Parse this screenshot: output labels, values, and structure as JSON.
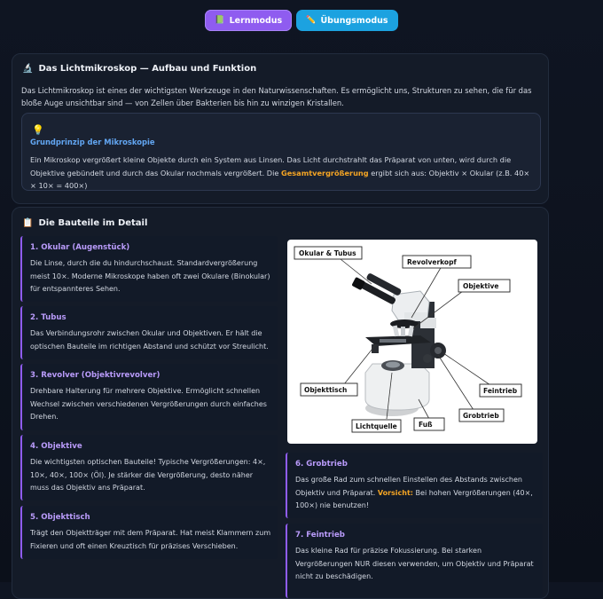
{
  "modes": {
    "learn": {
      "label": "Lernmodus",
      "icon": "book-icon"
    },
    "practice": {
      "label": "Übungsmodus",
      "icon": "pencil-icon"
    }
  },
  "intro_card": {
    "icon": "microscope-icon",
    "title": "Das Lichtmikroskop — Aufbau und Funktion",
    "text": "Das Lichtmikroskop ist eines der wichtigsten Werkzeuge in den Naturwissenschaften. Es ermöglicht uns, Strukturen zu sehen, die für das bloße Auge unsichtbar sind — von Zellen über Bakterien bis hin zu winzigen Kristallen.",
    "principle": {
      "icon": "lightbulb-icon",
      "title": "Grundprinzip der Mikroskopie",
      "text_before": "Ein Mikroskop vergrößert kleine Objekte durch ein System aus Linsen. Das Licht durchstrahlt das Präparat von unten, wird durch die Objektive gebündelt und durch das Okular nochmals vergrößert. Die ",
      "highlight": "Gesamtvergrößerung",
      "text_after": " ergibt sich aus: Objektiv × Okular (z.B. 40× × 10× = 400×)"
    }
  },
  "parts_card": {
    "icon": "clipboard-icon",
    "title": "Die Bauteile im Detail",
    "parts": [
      {
        "title": "1. Okular (Augenstück)",
        "text": "Die Linse, durch die du hindurchschaust. Standardvergrößerung meist 10×. Moderne Mikroskope haben oft zwei Okulare (Binokular) für entspannteres Sehen."
      },
      {
        "title": "2. Tubus",
        "text": "Das Verbindungsrohr zwischen Okular und Objektiven. Er hält die optischen Bauteile im richtigen Abstand und schützt vor Streulicht."
      },
      {
        "title": "3. Revolver (Objektivrevolver)",
        "text": "Drehbare Halterung für mehrere Objektive. Ermöglicht schnellen Wechsel zwischen verschiedenen Vergrößerungen durch einfaches Drehen."
      },
      {
        "title": "4. Objektive",
        "text": "Die wichtigsten optischen Bauteile! Typische Vergrößerungen: 4×, 10×, 40×, 100× (Öl). Je stärker die Vergrößerung, desto näher muss das Objektiv ans Präparat."
      },
      {
        "title": "5. Objekttisch",
        "text": "Trägt den Objektträger mit dem Präparat. Hat meist Klammern zum Fixieren und oft einen Kreuztisch für präzises Verschieben."
      },
      {
        "title": "6. Grobtrieb",
        "text_before": "Das große Rad zum schnellen Einstellen des Abstands zwischen Objektiv und Präparat. ",
        "warning": "Vorsicht:",
        "text_after": " Bei hohen Vergrößerungen (40×, 100×) nie benutzen!"
      },
      {
        "title": "7. Feintrieb",
        "text": "Das kleine Rad für präzise Fokussierung. Bei starken Vergrößerungen NUR diesen verwenden, um Objektiv und Präparat nicht zu beschädigen."
      }
    ],
    "diagram_labels": {
      "okular_tubus": "Okular & Tubus",
      "revolverkopf": "Revolverkopf",
      "objektive": "Objektive",
      "objekttisch": "Objekttisch",
      "feintrieb": "Feintrieb",
      "grobtrieb": "Grobtrieb",
      "lichtquelle": "Lichtquelle",
      "fuss": "Fuß"
    }
  }
}
